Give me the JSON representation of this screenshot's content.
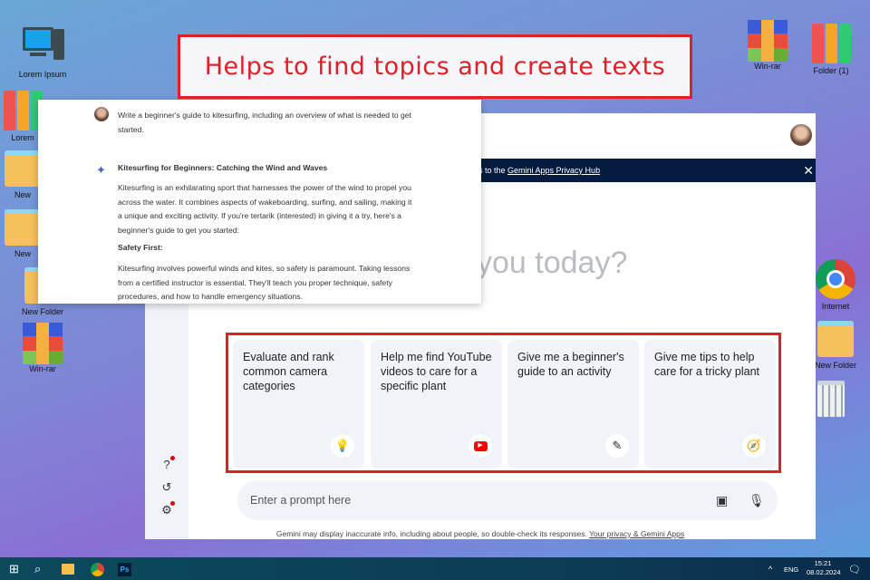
{
  "banner_title": "Helps to find topics and create texts",
  "desktop": {
    "left": [
      {
        "label": "Lorem Ipsum",
        "icon": "computer-icon"
      },
      {
        "label": "Lorem",
        "icon": "binders-icon"
      },
      {
        "label": "New",
        "icon": "folder-icon"
      },
      {
        "label": "New",
        "icon": "folder-icon"
      },
      {
        "label": "New Folder",
        "icon": "folder-icon"
      },
      {
        "label": "Win-rar",
        "icon": "winrar-icon"
      }
    ],
    "right": [
      {
        "label": "Win-rar",
        "icon": "winrar-icon"
      },
      {
        "label": "Folder (1)",
        "icon": "binders-icon"
      },
      {
        "label": "Internet",
        "icon": "chrome-icon"
      },
      {
        "label": "New Folder",
        "icon": "folder-icon"
      },
      {
        "label": "",
        "icon": "trash-icon"
      }
    ]
  },
  "chat": {
    "user_prompt": "Write a beginner's guide to kitesurfing, including an overview of what is needed to get started.",
    "response_title": "Kitesurfing for Beginners: Catching the Wind and Waves",
    "response_intro": "Kitesurfing is an exhilarating sport that harnesses the power of the wind to propel you across the water. It combines aspects of wakeboarding, surfing, and sailing, making it a unique and exciting activity. If you're tertarik (interested) in giving it a try, here's a beginner's guide to get you started:",
    "section_heading": "Safety First:",
    "section_text": "Kitesurfing involves powerful winds and kites, so safety is paramount.  Taking lessons from a certified instructor is essential. They'll teach you proper technique, safety procedures, and how to handle emergency situations."
  },
  "gemini": {
    "banner_text": "s to the ",
    "banner_link": "Gemini Apps Privacy Hub",
    "greeting": "you today?",
    "cards": [
      {
        "text": "Evaluate and rank common camera categories",
        "icon": "lightbulb-icon"
      },
      {
        "text": "Help me find YouTube videos to care for a specific plant",
        "icon": "youtube-icon"
      },
      {
        "text": "Give me a beginner's guide to an activity",
        "icon": "pen-sparkle-icon"
      },
      {
        "text": "Give me tips to help care for a tricky plant",
        "icon": "compass-icon"
      }
    ],
    "prompt_placeholder": "Enter a prompt here",
    "footer_text": "Gemini may display inaccurate info, including about people, so double-check its responses. ",
    "footer_link": "Your privacy & Gemini Apps"
  },
  "taskbar": {
    "lang": "ENG",
    "time": "15:21",
    "date": "08.02.2024"
  },
  "colors": {
    "accent_red": "#e01f26",
    "banner_navy": "#051b3f",
    "card_bg": "#f0f4f9"
  }
}
